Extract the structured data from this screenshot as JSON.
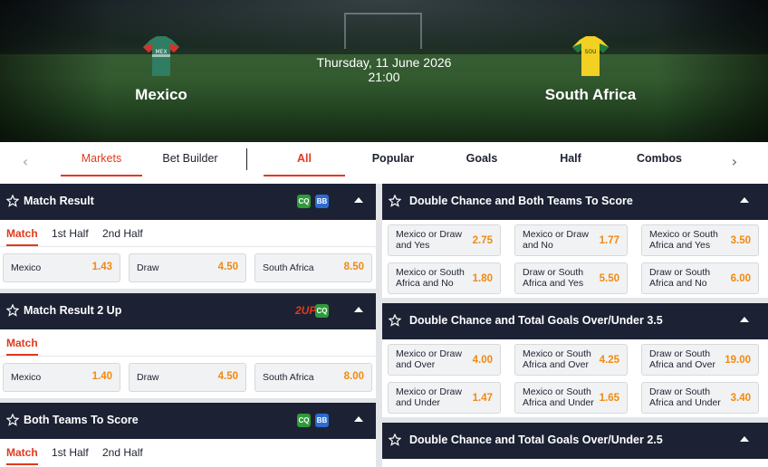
{
  "event": {
    "home": "Mexico",
    "away": "South Africa",
    "home_short": "MEX",
    "away_short": "SOU",
    "date": "Thursday, 11 June 2026",
    "time": "21:00"
  },
  "tabs": {
    "markets": "Markets",
    "bet_builder": "Bet Builder",
    "all": "All",
    "popular": "Popular",
    "goals": "Goals",
    "half": "Half",
    "combos": "Combos"
  },
  "badges": {
    "cq": "CQ",
    "bb": "BB",
    "zip": "2UP"
  },
  "left": {
    "match_result": {
      "title": "Match Result",
      "subtabs": [
        "Match",
        "1st Half",
        "2nd Half"
      ],
      "odds": [
        {
          "label": "Mexico",
          "value": "1.43"
        },
        {
          "label": "Draw",
          "value": "4.50"
        },
        {
          "label": "South Africa",
          "value": "8.50"
        }
      ]
    },
    "match_result_2up": {
      "title": "Match Result 2 Up",
      "subtabs": [
        "Match"
      ],
      "odds": [
        {
          "label": "Mexico",
          "value": "1.40"
        },
        {
          "label": "Draw",
          "value": "4.50"
        },
        {
          "label": "South Africa",
          "value": "8.00"
        }
      ]
    },
    "btts": {
      "title": "Both Teams To Score",
      "subtabs": [
        "Match",
        "1st Half",
        "2nd Half"
      ]
    }
  },
  "right": {
    "dc_btts": {
      "title": "Double Chance and Both Teams To Score",
      "odds": [
        {
          "l1": "Mexico or Draw",
          "l2": "and Yes",
          "value": "2.75"
        },
        {
          "l1": "Mexico or Draw",
          "l2": "and No",
          "value": "1.77"
        },
        {
          "l1": "Mexico or South",
          "l2": "Africa and Yes",
          "value": "3.50"
        },
        {
          "l1": "Mexico or South",
          "l2": "Africa and No",
          "value": "1.80"
        },
        {
          "l1": "Draw or South",
          "l2": "Africa and Yes",
          "value": "5.50"
        },
        {
          "l1": "Draw or South",
          "l2": "Africa and No",
          "value": "6.00"
        }
      ]
    },
    "dc_tg35": {
      "title": "Double Chance and Total Goals Over/Under 3.5",
      "odds": [
        {
          "l1": "Mexico or Draw",
          "l2": "and Over",
          "value": "4.00"
        },
        {
          "l1": "Mexico or South",
          "l2": "Africa and Over",
          "value": "4.25"
        },
        {
          "l1": "Draw or South",
          "l2": "Africa and Over",
          "value": "19.00"
        },
        {
          "l1": "Mexico or Draw",
          "l2": "and Under",
          "value": "1.47"
        },
        {
          "l1": "Mexico or South",
          "l2": "Africa and Under",
          "value": "1.65"
        },
        {
          "l1": "Draw or South",
          "l2": "Africa and Under",
          "value": "3.40"
        }
      ]
    },
    "dc_tg25": {
      "title": "Double Chance and Total Goals Over/Under 2.5"
    }
  },
  "colors": {
    "accent": "#e03a1e",
    "odds": "#f08a10",
    "header": "#1c2234"
  }
}
